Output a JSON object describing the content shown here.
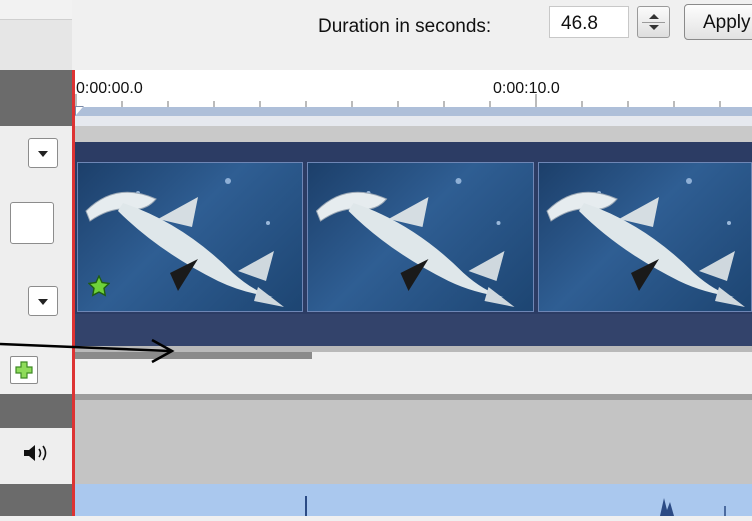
{
  "toolbar": {
    "duration_label": "Duration in seconds:",
    "duration_value": "46.8",
    "apply_label": "Apply"
  },
  "timeline": {
    "ruler_labels": [
      "0:00:00.0",
      "0:00:10.0"
    ]
  },
  "video_track": {
    "thumbnail_count": 3,
    "thumbnail_subject": "hammerhead shark"
  },
  "icons": {
    "add_track": "plus-icon",
    "audio": "speaker-icon",
    "effect_marker": "star-icon",
    "dropdown": "chevron-down-icon"
  },
  "colors": {
    "playhead": "#d33333",
    "video_track_bg": "#2c3c64",
    "ruler_band": "#aebfd9",
    "waveform_bg": "#aac8ee",
    "audio_track_bg": "#c4c4c4",
    "effect_star": "#6fd23a"
  }
}
